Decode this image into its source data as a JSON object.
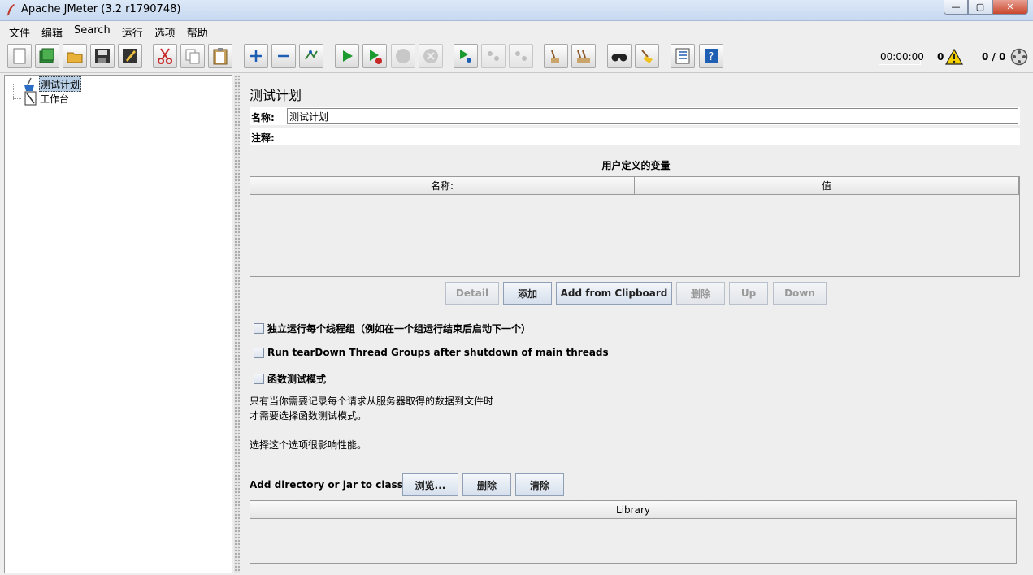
{
  "window": {
    "title": "Apache JMeter (3.2 r1790748)",
    "buttons": {
      "minimize": "—",
      "maximize": "▢",
      "close": "✕"
    }
  },
  "menu": [
    "文件",
    "编辑",
    "Search",
    "运行",
    "选项",
    "帮助"
  ],
  "toolbar": {
    "icons": [
      "new-icon",
      "templates-icon",
      "open-icon",
      "save-icon",
      "save-as-icon",
      "cut-icon",
      "copy-icon",
      "paste-icon",
      "expand-icon",
      "collapse-icon",
      "toggle-icon",
      "start-icon",
      "start-no-pause-icon",
      "stop-icon",
      "shutdown-icon",
      "remote-start-icon",
      "remote-stop-icon",
      "remote-shutdown-icon",
      "clear-icon",
      "clear-all-icon",
      "search-icon",
      "reset-search-icon",
      "function-helper-icon",
      "help-icon"
    ],
    "timer": "00:00:00",
    "error_count": "0",
    "thread_count": "0 / 0"
  },
  "tree": {
    "items": [
      {
        "label": "测试计划",
        "icon": "test-plan-icon",
        "selected": true
      },
      {
        "label": "工作台",
        "icon": "workbench-icon",
        "selected": false
      }
    ]
  },
  "panel": {
    "heading": "测试计划",
    "name_label": "名称:",
    "name_value": "测试计划",
    "comment_label": "注释:",
    "comment_value": "",
    "variables_title": "用户定义的变量",
    "columns": [
      "名称:",
      "值"
    ],
    "buttons": {
      "detail": "Detail",
      "add": "添加",
      "add_clipboard": "Add from Clipboard",
      "delete": "删除",
      "up": "Up",
      "down": "Down"
    },
    "checkboxes": [
      {
        "label": "独立运行每个线程组（例如在一个组运行结束后启动下一个）",
        "checked": false
      },
      {
        "label": "Run tearDown Thread Groups after shutdown of main threads",
        "checked": false
      },
      {
        "label": "函数测试模式",
        "checked": false
      }
    ],
    "info_line1": "只有当你需要记录每个请求从服务器取得的数据到文件时",
    "info_line2": "才需要选择函数测试模式。",
    "info_line3": "选择这个选项很影响性能。",
    "classpath_label": "Add directory or jar to classpath",
    "classpath_buttons": {
      "browse": "浏览...",
      "delete": "删除",
      "clear": "清除"
    },
    "library_header": "Library"
  }
}
